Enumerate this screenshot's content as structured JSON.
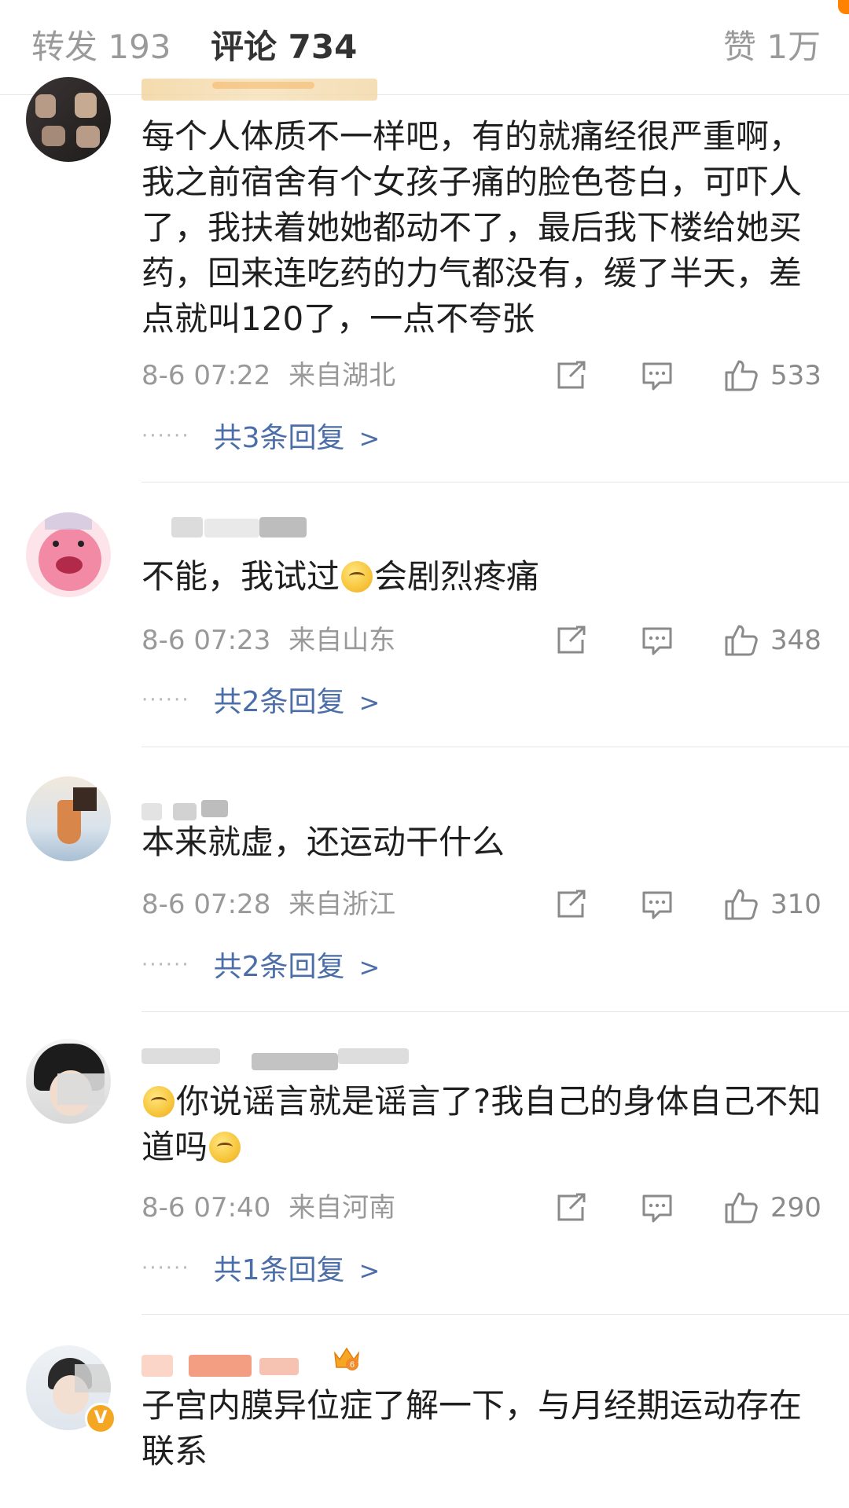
{
  "tabs": {
    "repost": "转发 193",
    "comments": "评论 734",
    "likes": "赞 1万"
  },
  "colors": {
    "accent": "#ff8200",
    "link": "#4b6ea8",
    "meta": "#999999"
  },
  "comments": [
    {
      "text": "每个人体质不一样吧，有的就痛经很严重啊，我之前宿舍有个女孩子痛的脸色苍白，可吓人了，我扶着她她都动不了，最后我下楼给她买药，回来连吃药的力气都没有，缓了半天，差点就叫120了，一点不夸张",
      "time": "8-6 07:22",
      "location": "来自湖北",
      "likes": "533",
      "replies": "共3条回复"
    },
    {
      "text_before": "不能，我试过",
      "text_after": "会剧烈疼痛",
      "time": "8-6 07:23",
      "location": "来自山东",
      "likes": "348",
      "replies": "共2条回复"
    },
    {
      "text": "本来就虚，还运动干什么",
      "time": "8-6 07:28",
      "location": "来自浙江",
      "likes": "310",
      "replies": "共2条回复"
    },
    {
      "text_main": "你说谣言就是谣言了?我自己的身体自己不知道吗",
      "time": "8-6 07:40",
      "location": "来自河南",
      "likes": "290",
      "replies": "共1条回复"
    },
    {
      "text": "子宫内膜异位症了解一下，与月经期运动存在联系",
      "badge": "6"
    }
  ],
  "icons": [
    "repost-icon",
    "comment-icon",
    "like-icon",
    "chevron-right-icon",
    "verified-icon",
    "crown-icon"
  ]
}
